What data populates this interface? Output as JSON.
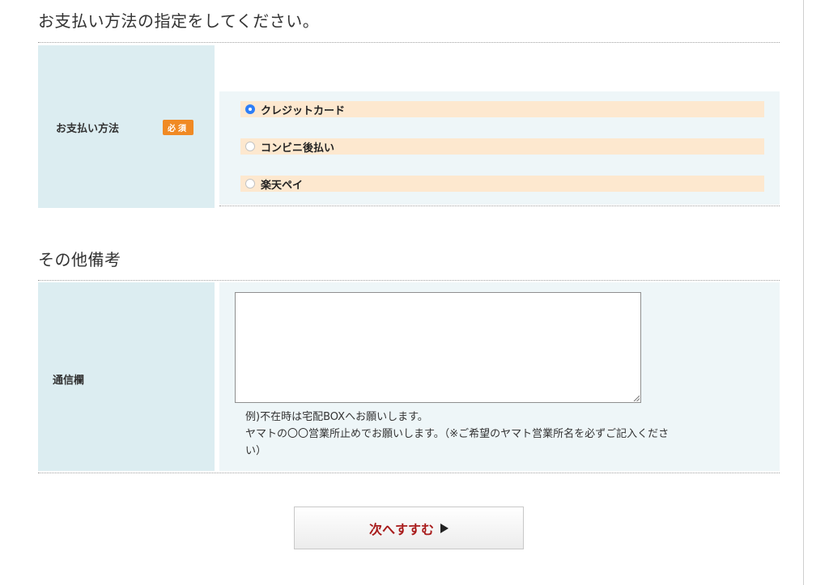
{
  "payment_section": {
    "title": "お支払い方法の指定をしてください。",
    "field_label": "お支払い方法",
    "required_badge": "必須",
    "options": [
      {
        "label": "クレジットカード",
        "selected": true
      },
      {
        "label": "コンビニ後払い",
        "selected": false
      },
      {
        "label": "楽天ペイ",
        "selected": false
      }
    ]
  },
  "notes_section": {
    "title": "その他備考",
    "field_label": "通信欄",
    "textarea_value": "",
    "hint_line1": "例)不在時は宅配BOXへお願いします。",
    "hint_line2": "ヤマトの〇〇営業所止めでお願いします。（※ご希望のヤマト営業所名を必ずご記入くださ",
    "hint_line3": "い）"
  },
  "next_button": {
    "label": "次へすすむ",
    "icon": "triangle-right-icon"
  },
  "colors": {
    "label_bg": "#dcedf1",
    "option_bg": "#fde8cf",
    "badge": "#f08a24",
    "radio_selected": "#2d7ef7",
    "button_text": "#a81b1b"
  }
}
